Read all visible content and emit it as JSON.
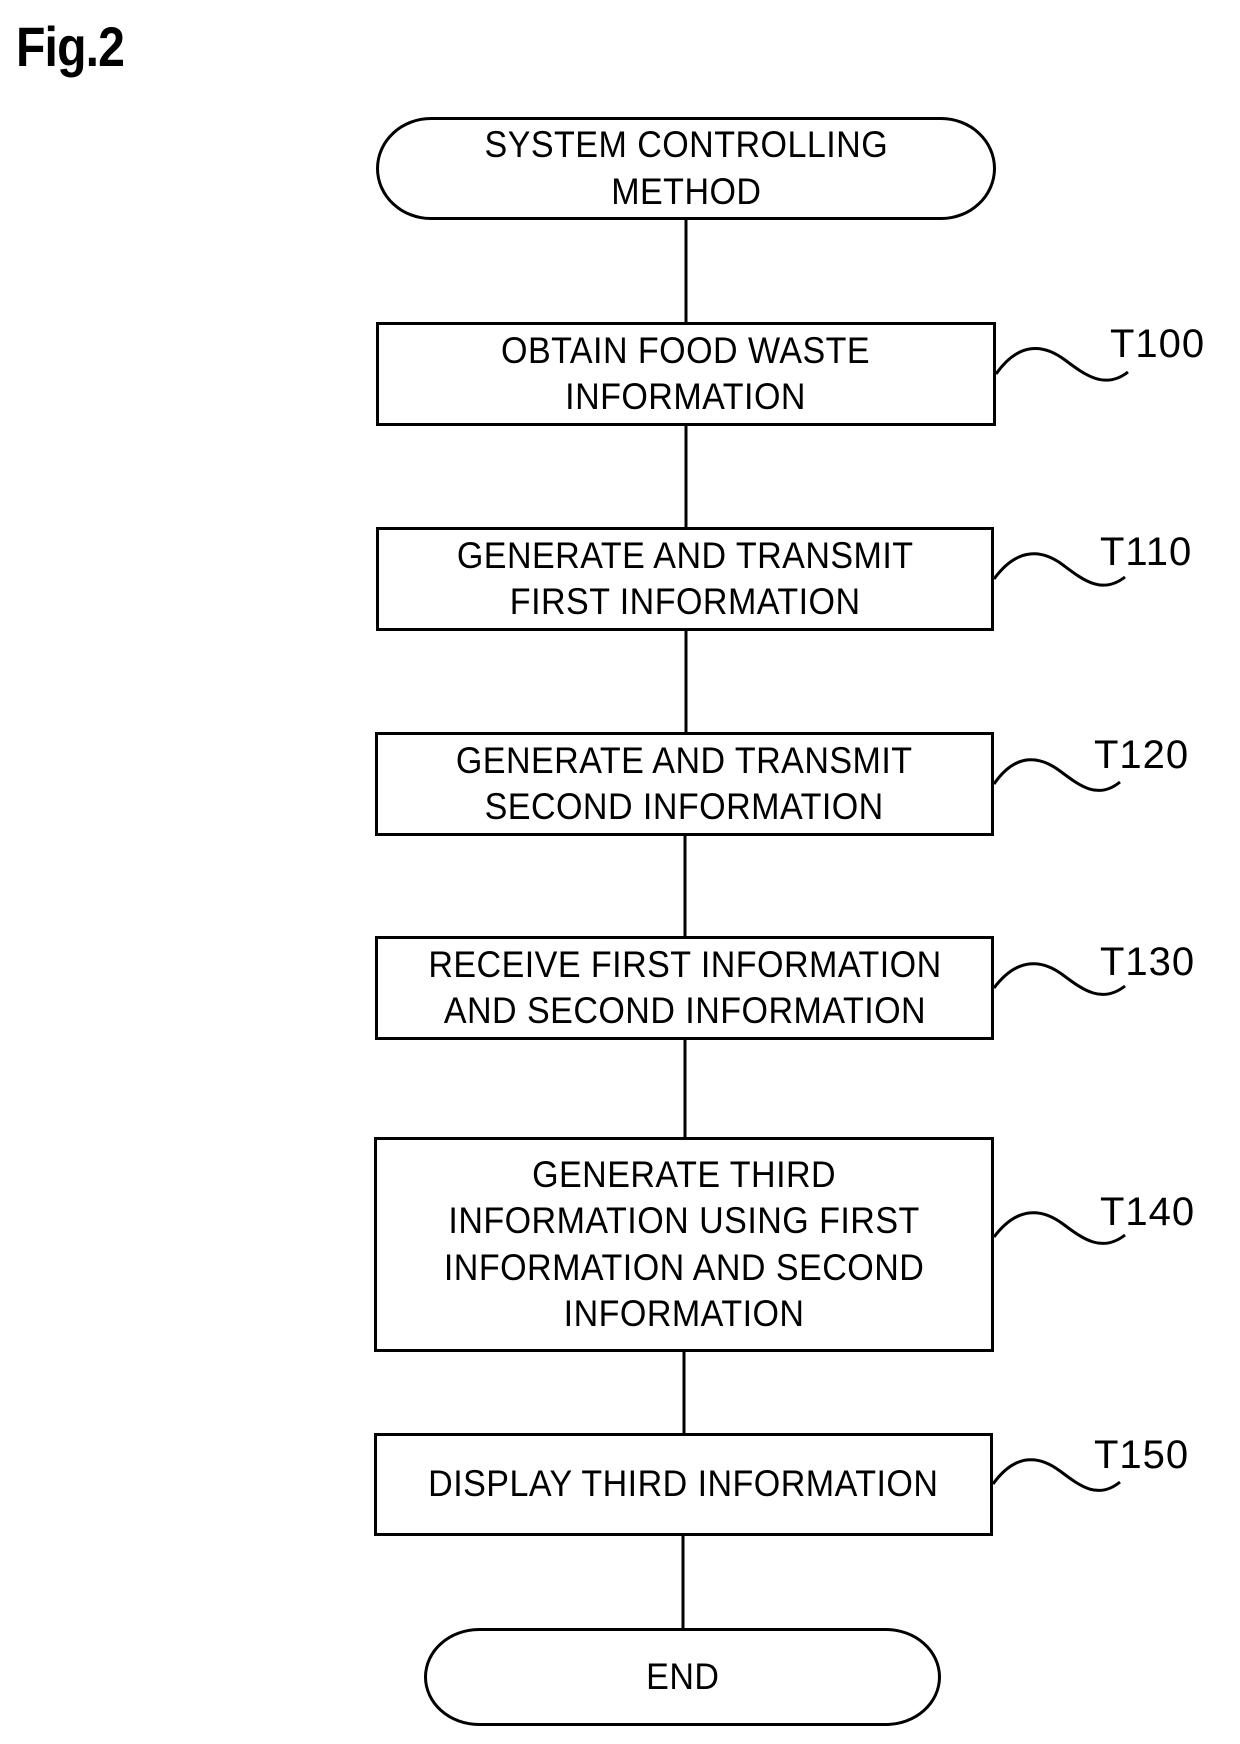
{
  "figure": {
    "title": "Fig.2"
  },
  "flowchart": {
    "start": {
      "label": "SYSTEM CONTROLLING\nMETHOD"
    },
    "steps": [
      {
        "id": "T100",
        "label": "OBTAIN FOOD WASTE\nINFORMATION"
      },
      {
        "id": "T110",
        "label": "GENERATE AND TRANSMIT\nFIRST INFORMATION"
      },
      {
        "id": "T120",
        "label": "GENERATE AND TRANSMIT\nSECOND INFORMATION"
      },
      {
        "id": "T130",
        "label": "RECEIVE FIRST INFORMATION\nAND SECOND INFORMATION"
      },
      {
        "id": "T140",
        "label": "GENERATE THIRD\nINFORMATION USING FIRST\nINFORMATION AND SECOND\nINFORMATION"
      },
      {
        "id": "T150",
        "label": "DISPLAY THIRD INFORMATION"
      }
    ],
    "end": {
      "label": "END"
    }
  }
}
